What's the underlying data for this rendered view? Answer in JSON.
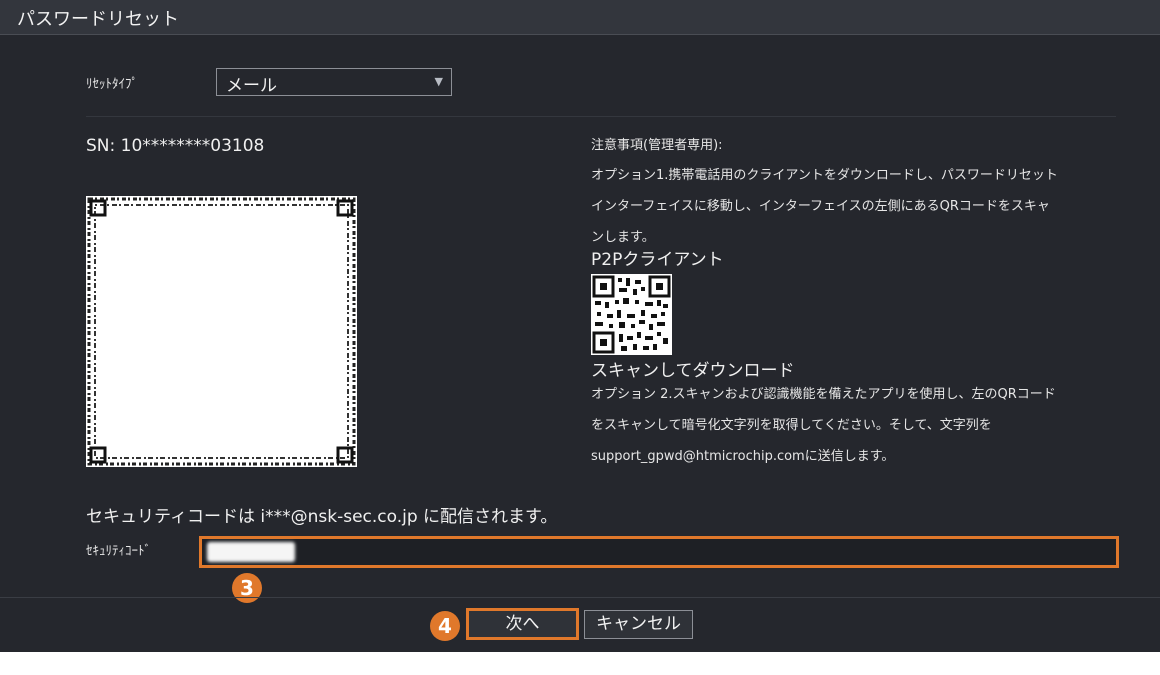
{
  "window": {
    "title": "パスワードリセット"
  },
  "reset_type": {
    "label": "ﾘｾｯﾄﾀｲﾌﾟ",
    "value": "メール",
    "arrow_icon": "caret-down-icon"
  },
  "serial": {
    "text": "SN: 10********03108"
  },
  "notice": {
    "title": "注意事項(管理者専用):",
    "option1_lines": [
      "オプション1.携帯電話用のクライアントをダウンロードし、パスワードリセット",
      "インターフェイスに移動し、インターフェイスの左側にあるQRコードをスキャ",
      "ンします。"
    ],
    "p2p_heading": "P2Pクライアント",
    "scan_heading": "スキャンしてダウンロード",
    "option2_lines": [
      "オプション 2.スキャンおよび認識機能を備えたアプリを使用し、左のQRコード",
      "をスキャンして暗号化文字列を取得してください。そして、文字列を",
      "support_gpwd@htmicrochip.comに送信します。"
    ]
  },
  "security": {
    "delivery_text": "セキュリティコードは i***@nsk-sec.co.jp に配信されます。",
    "code_label": "ｾｷｭﾘﾃｨｺｰﾄﾞ"
  },
  "steps": {
    "step3": "3",
    "step4": "4"
  },
  "buttons": {
    "next": "次へ",
    "cancel": "キャンセル"
  },
  "colors": {
    "accent": "#e0782b",
    "background": "#25272d",
    "title_bar": "#33363d"
  }
}
